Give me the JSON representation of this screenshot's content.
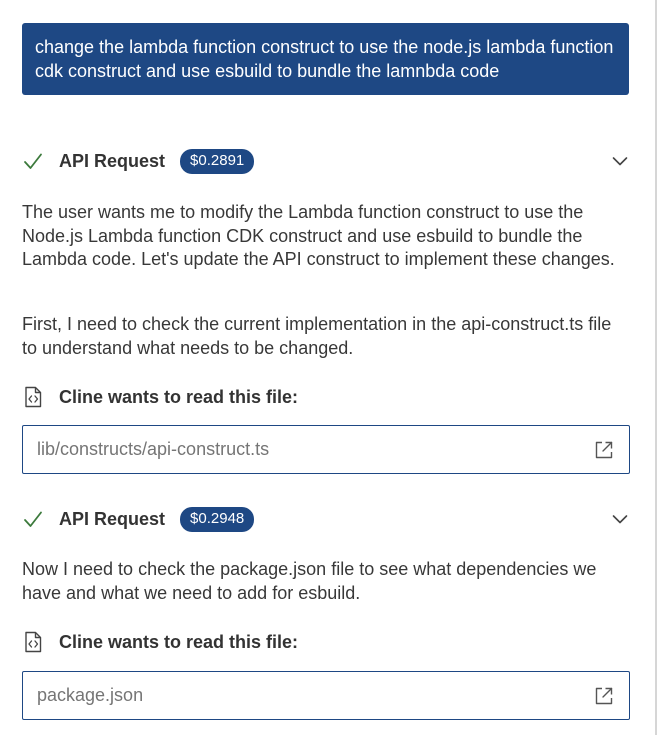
{
  "user_message": "change the lambda function construct to use the node.js lambda function cdk construct and use esbuild to bundle the lamnbda code",
  "blocks": [
    {
      "api_request": {
        "label": "API Request",
        "cost": "$0.2891",
        "status_icon": "check-icon",
        "expand_icon": "chevron-down-icon"
      },
      "paragraphs": [
        "The user wants me to modify the Lambda function construct to use the Node.js Lambda function CDK construct and use esbuild to bundle the Lambda code. Let's update the API construct to implement these changes.",
        "First, I need to check the current implementation in the api-construct.ts file to understand what needs to be changed."
      ],
      "read_file": {
        "label": "Cline wants to read this file:",
        "path": "lib/constructs/api-construct.ts",
        "icon": "file-code-icon",
        "open_icon": "open-external-icon"
      }
    },
    {
      "api_request": {
        "label": "API Request",
        "cost": "$0.2948",
        "status_icon": "check-icon",
        "expand_icon": "chevron-down-icon"
      },
      "paragraphs": [
        "Now I need to check the package.json file to see what dependencies we have and what we need to add for esbuild."
      ],
      "read_file": {
        "label": "Cline wants to read this file:",
        "path": "package.json",
        "icon": "file-code-icon",
        "open_icon": "open-external-icon"
      }
    }
  ],
  "colors": {
    "accent": "#1e4884",
    "check": "#3c7a3c",
    "text": "#383838",
    "muted": "#757575"
  }
}
